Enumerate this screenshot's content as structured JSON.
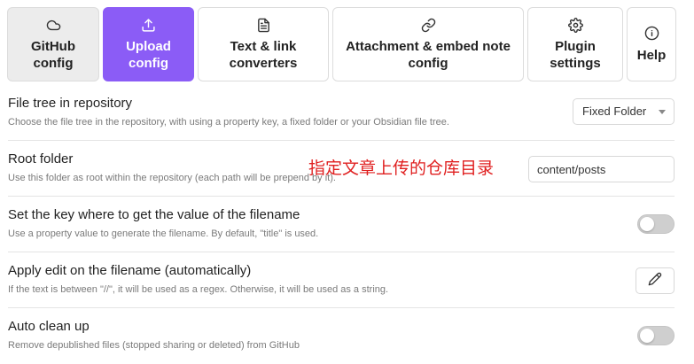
{
  "tabs": [
    {
      "line1": "GitHub",
      "line2": "config",
      "icon": "cloud-icon"
    },
    {
      "line1": "Upload",
      "line2": "config",
      "icon": "upload-icon"
    },
    {
      "line1": "Text & link",
      "line2": "converters",
      "icon": "file-text-icon"
    },
    {
      "line1": "Attachment & embed note",
      "line2": "config",
      "icon": "link-icon"
    },
    {
      "line1": "Plugin",
      "line2": "settings",
      "icon": "gear-icon"
    },
    {
      "line1": "Help",
      "line2": "",
      "icon": "help-circle-icon"
    }
  ],
  "active_tab": "Upload config",
  "colors": {
    "accent": "#8b5cf6",
    "annotation": "#e02020"
  },
  "settings": {
    "file_tree": {
      "name": "File tree in repository",
      "desc": "Choose the file tree in the repository, with using a property key, a fixed folder or your Obsidian file tree.",
      "value": "Fixed Folder"
    },
    "root_folder": {
      "name": "Root folder",
      "desc": "Use this folder as root within the repository (each path will be prepend by it).",
      "value": "content/posts",
      "annotation": "指定文章上传的仓库目录"
    },
    "filename_key": {
      "name": "Set the key where to get the value of the filename",
      "desc": "Use a property value to generate the filename. By default, \"title\" is used.",
      "enabled": false
    },
    "edit_filename": {
      "name": "Apply edit on the filename (automatically)",
      "desc": "If the text is between \"//\", it will be used as a regex. Otherwise, it will be used as a string.",
      "icon": "pencil-icon"
    },
    "auto_clean": {
      "name": "Auto clean up",
      "desc": "Remove depublished files (stopped sharing or deleted) from GitHub",
      "enabled": false
    }
  }
}
